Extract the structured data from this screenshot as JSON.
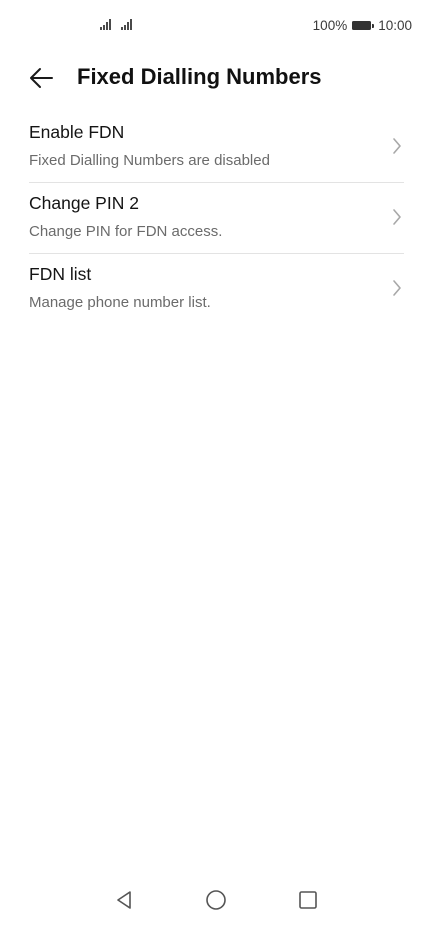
{
  "status_bar": {
    "battery_percent": "100%",
    "time": "10:00",
    "signal_icons": [
      "signal-strength-icon",
      "signal-strength-icon"
    ],
    "battery_icon": "battery-icon"
  },
  "header": {
    "back_icon": "arrow-left-icon",
    "title": "Fixed Dialling Numbers"
  },
  "items": [
    {
      "title": "Enable FDN",
      "subtitle": "Fixed Dialling Numbers are disabled",
      "icon": "chevron-right-icon"
    },
    {
      "title": "Change PIN 2",
      "subtitle": "Change PIN for FDN access.",
      "icon": "chevron-right-icon"
    },
    {
      "title": "FDN list",
      "subtitle": "Manage phone number list.",
      "icon": "chevron-right-icon"
    }
  ],
  "nav_bar": {
    "back_icon": "triangle-back-icon",
    "home_icon": "circle-home-icon",
    "recents_icon": "square-recents-icon"
  },
  "colors": {
    "background": "#ffffff",
    "title_text": "#111111",
    "subtitle_text": "#6b6b6b",
    "divider": "#e3e3e3",
    "chevron": "#a8a8a8"
  }
}
